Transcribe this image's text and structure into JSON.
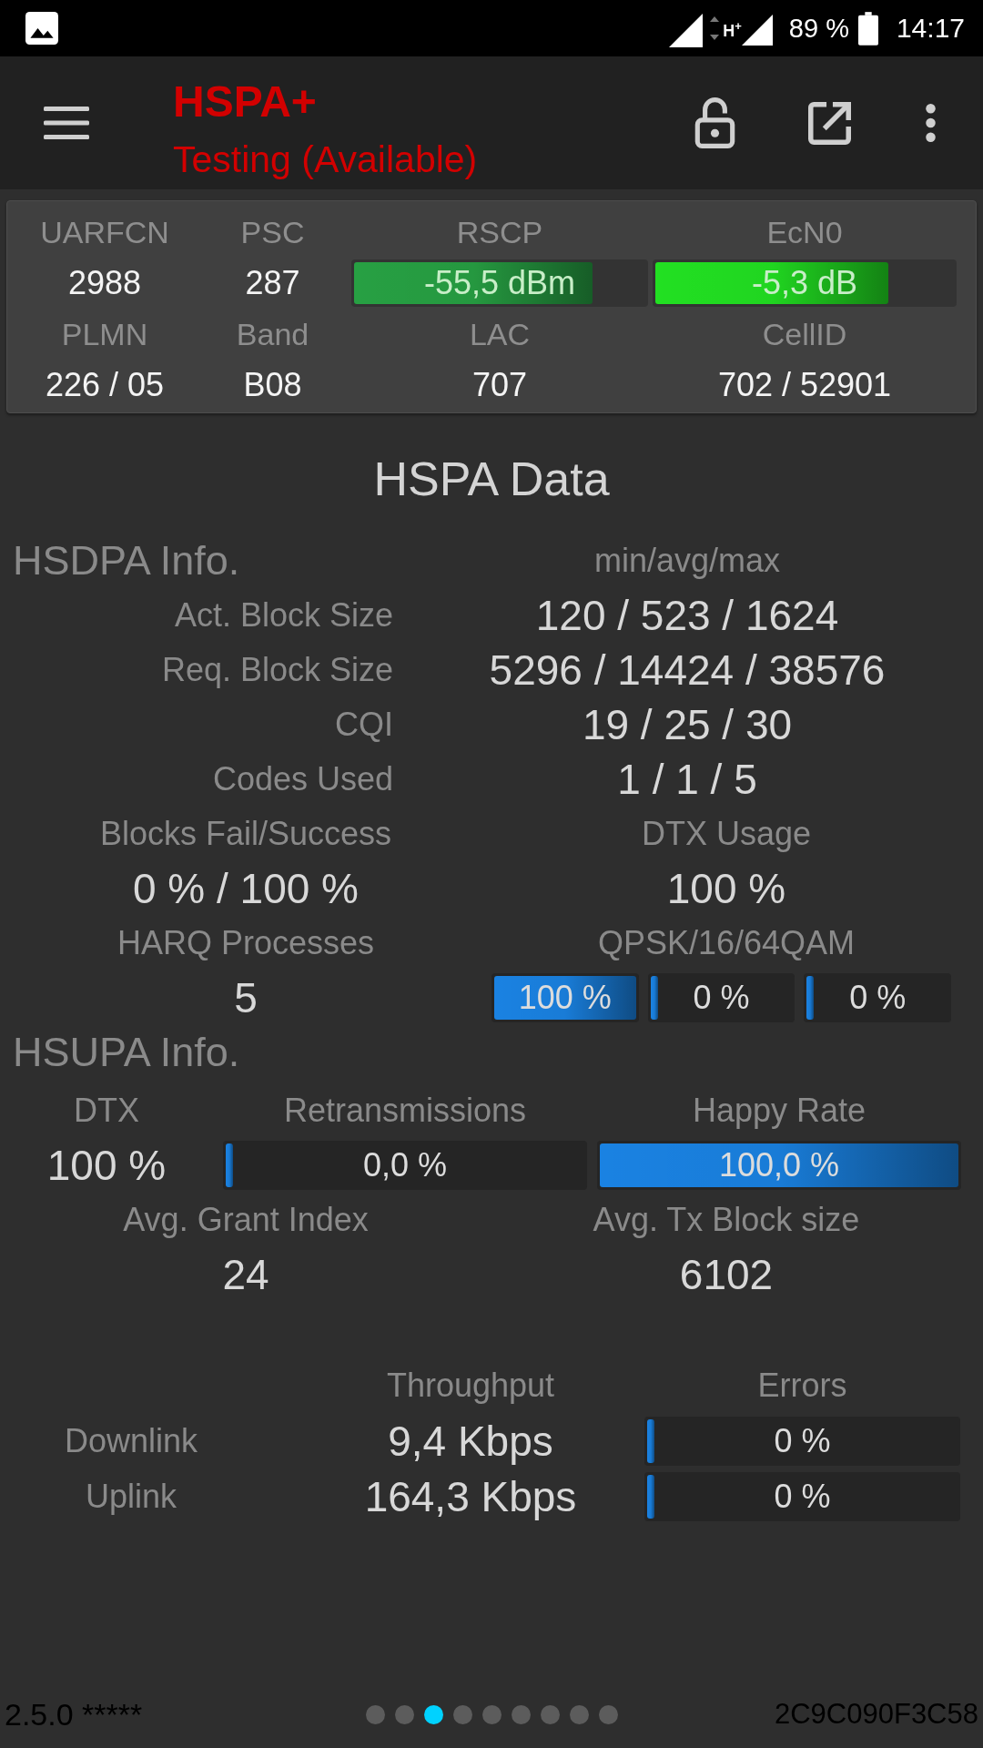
{
  "status_bar": {
    "network_type": "H$^{+}$",
    "battery": "89 %",
    "time": "14:17"
  },
  "app_bar": {
    "title": "HSPA+",
    "subtitle": "Testing (Available)"
  },
  "cell_info": {
    "rows": [
      [
        {
          "kind": "text",
          "label": "UARFCN",
          "value": "2988"
        },
        {
          "kind": "text",
          "label": "PSC",
          "value": "287"
        },
        {
          "kind": "meter",
          "label": "RSCP",
          "reading": "-55,5 dBm",
          "level": 0.82,
          "color": "#27a043"
        },
        {
          "kind": "meter",
          "label": "EcN0",
          "reading": "-5,3 dB",
          "level": 0.78,
          "color": "#22e022"
        }
      ],
      [
        {
          "kind": "text",
          "label": "PLMN",
          "value": "226 / 05"
        },
        {
          "kind": "text",
          "label": "Band",
          "value": "B08"
        },
        {
          "kind": "text",
          "label": "LAC",
          "value": "707"
        },
        {
          "kind": "text",
          "label": "CellID",
          "value": "702 / 52901"
        }
      ]
    ]
  },
  "hspa_data": {
    "title": "HSPA Data",
    "hsdpa": {
      "heading": "HSDPA Info.",
      "stats_header": "min/avg/max",
      "stats": [
        {
          "label": "Act. Block Size",
          "value": "120 / 523 / 1624"
        },
        {
          "label": "Req. Block Size",
          "value": "5296 / 14424 / 38576"
        },
        {
          "label": "CQI",
          "value": "19 / 25 / 30"
        },
        {
          "label": "Codes Used",
          "value": "1 / 1 / 5"
        }
      ],
      "rows": [
        [
          {
            "kind": "text",
            "label": "Blocks Fail/Success",
            "value": "0 % / 100 %"
          },
          {
            "kind": "text",
            "label": "DTX Usage",
            "value": "100 %"
          }
        ],
        [
          {
            "kind": "text",
            "label": "HARQ Processes",
            "value": "5"
          },
          {
            "kind": "meters",
            "label": "QPSK/16/64QAM",
            "meters": [
              {
                "reading": "100 %",
                "level": 1
              },
              {
                "reading": "0 %",
                "level": 0
              },
              {
                "reading": "0 %",
                "level": 0
              }
            ]
          }
        ]
      ]
    },
    "hsupa": {
      "heading": "HSUPA Info.",
      "metrics": [
        {
          "kind": "text",
          "label": "DTX",
          "value": "100 %"
        },
        {
          "kind": "meter",
          "label": "Retransmissions",
          "reading": "0,0 %",
          "level": 0
        },
        {
          "kind": "meter",
          "label": "Happy Rate",
          "reading": "100,0 %",
          "level": 1
        }
      ],
      "averages": [
        {
          "kind": "text",
          "label": "Avg. Grant Index",
          "value": "24"
        },
        {
          "kind": "text",
          "label": "Avg. Tx Block size",
          "value": "6102"
        }
      ]
    },
    "link_stats": {
      "throughput_header": "Throughput",
      "errors_header": "Errors",
      "rows": [
        {
          "label": "Downlink",
          "throughput": "9,4 Kbps",
          "errors": {
            "reading": "0 %",
            "level": 0
          }
        },
        {
          "label": "Uplink",
          "throughput": "164,3 Kbps",
          "errors": {
            "reading": "0 %",
            "level": 0
          }
        }
      ]
    }
  },
  "footer": {
    "version": "2.5.0 *****",
    "pages": [
      {
        "selected": false
      },
      {
        "selected": false
      },
      {
        "selected": true
      },
      {
        "selected": false
      },
      {
        "selected": false
      },
      {
        "selected": false
      },
      {
        "selected": false
      },
      {
        "selected": false
      },
      {
        "selected": false
      }
    ],
    "device_id": "2C9C090F3C58"
  }
}
